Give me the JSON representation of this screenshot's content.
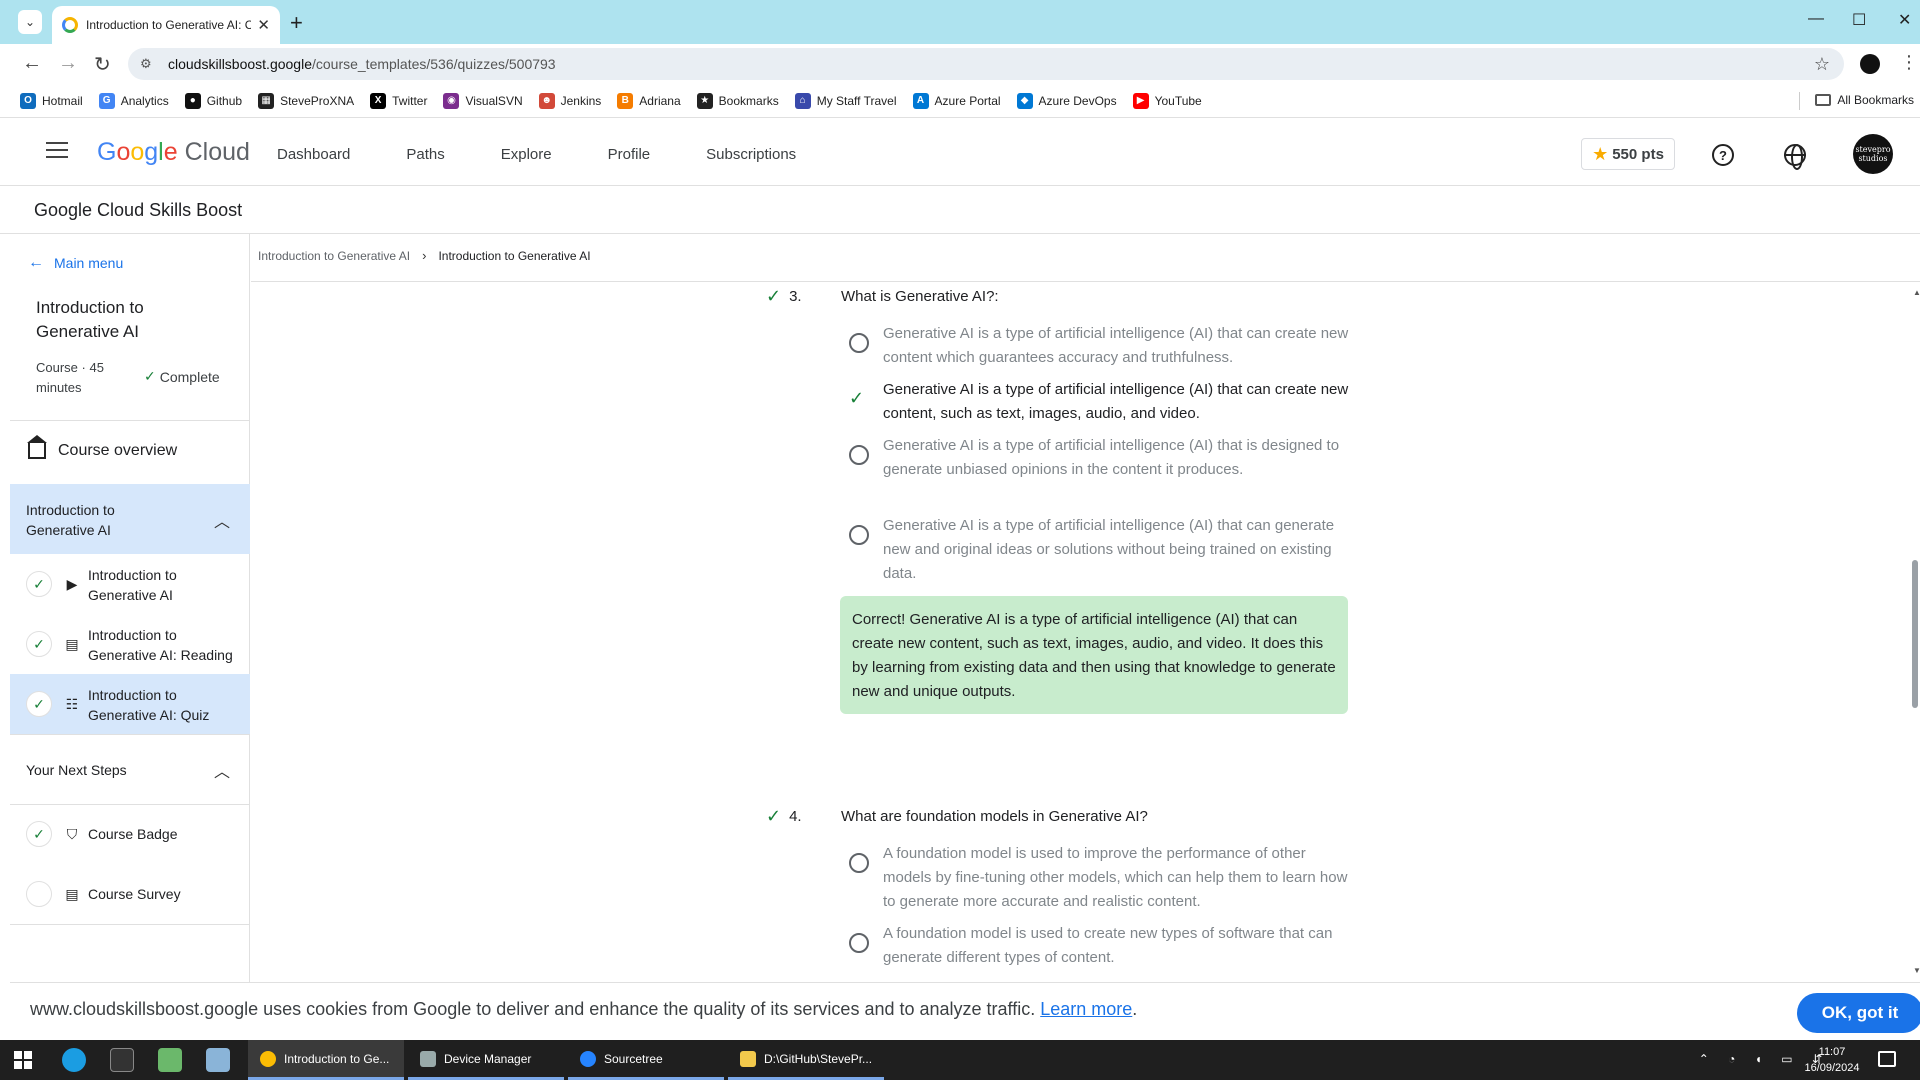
{
  "browser": {
    "tab_title": "Introduction to Generative AI: C",
    "url_host": "cloudskillsboost.google",
    "url_path": "/course_templates/536/quizzes/500793",
    "bookmarks": [
      {
        "label": "Hotmail",
        "color": "#0f6cbd",
        "glyph": "O"
      },
      {
        "label": "Analytics",
        "color": "#4285f4",
        "glyph": "G"
      },
      {
        "label": "Github",
        "color": "#111111",
        "glyph": "●"
      },
      {
        "label": "SteveProXNA",
        "color": "#222222",
        "glyph": "▦"
      },
      {
        "label": "Twitter",
        "color": "#000000",
        "glyph": "X"
      },
      {
        "label": "VisualSVN",
        "color": "#7b2d8e",
        "glyph": "◉"
      },
      {
        "label": "Jenkins",
        "color": "#d24939",
        "glyph": "☻"
      },
      {
        "label": "Adriana",
        "color": "#f57c00",
        "glyph": "B"
      },
      {
        "label": "Bookmarks",
        "color": "#222222",
        "glyph": "★"
      },
      {
        "label": "My Staff Travel",
        "color": "#3949ab",
        "glyph": "⌂"
      },
      {
        "label": "Azure Portal",
        "color": "#0078d4",
        "glyph": "A"
      },
      {
        "label": "Azure DevOps",
        "color": "#0078d4",
        "glyph": "◆"
      },
      {
        "label": "YouTube",
        "color": "#ff0000",
        "glyph": "▶"
      }
    ],
    "all_bookmarks": "All Bookmarks"
  },
  "header": {
    "logo_google": [
      "G",
      "o",
      "o",
      "g",
      "l",
      "e"
    ],
    "logo_cloud": "Cloud",
    "nav": [
      "Dashboard",
      "Paths",
      "Explore",
      "Profile",
      "Subscriptions"
    ],
    "points": "550 pts",
    "help_glyph": "?",
    "avatar_text": "stevepro studios"
  },
  "skills_title": "Google Cloud Skills Boost",
  "sidebar": {
    "main_menu": "Main menu",
    "course_title": "Introduction to Generative AI",
    "course_meta": "Course · 45 minutes",
    "course_status": "Complete",
    "overview": "Course overview",
    "section1": "Introduction to Generative AI",
    "items": [
      {
        "label": "Introduction to Generative AI",
        "icon": "play-circle-icon",
        "glyph": "▶",
        "done": true
      },
      {
        "label": "Introduction to Generative AI: Reading",
        "icon": "document-icon",
        "glyph": "▤",
        "done": true
      },
      {
        "label": "Introduction to Generative AI: Quiz",
        "icon": "quiz-icon",
        "glyph": "☷",
        "done": true
      }
    ],
    "section2": "Your Next Steps",
    "next_steps": [
      {
        "label": "Course Badge",
        "icon": "badge-shield-icon",
        "glyph": "⛉",
        "done": true
      },
      {
        "label": "Course Survey",
        "icon": "document-icon",
        "glyph": "▤",
        "done": false
      }
    ]
  },
  "breadcrumb": {
    "parent": "Introduction to Generative AI",
    "current": "Introduction to Generative AI"
  },
  "quiz": {
    "q3": {
      "number": "3.",
      "text": "What is Generative AI?:",
      "options": [
        "Generative AI is a type of artificial intelligence (AI) that can create new content which guarantees accuracy and truthfulness.",
        "Generative AI is a type of artificial intelligence (AI) that can create new content, such as text, images, audio, and video.",
        "Generative AI is a type of artificial intelligence (AI) that is designed to generate unbiased opinions in the content it produces.",
        "Generative AI is a type of artificial intelligence (AI) that can generate new and original ideas or solutions without being trained on existing data."
      ],
      "feedback": "Correct! Generative AI is a type of artificial intelligence (AI) that can create new content, such as text, images, audio, and video. It does this by learning from existing data and then using that knowledge to generate new and unique outputs."
    },
    "q4": {
      "number": "4.",
      "text": "What are foundation models in Generative AI?",
      "options": [
        "A foundation model is used to improve the performance of other models by fine-tuning other models, which can help them to learn how to generate more accurate and realistic content.",
        "A foundation model is used to create new types of software that can generate different types of content."
      ]
    }
  },
  "cookie": {
    "message": "www.cloudskillsboost.google uses cookies from Google to deliver and enhance the quality of its services and to analyze traffic.",
    "learn_more": "Learn more",
    "period": ".",
    "ok": "OK, got it"
  },
  "taskbar": {
    "apps": [
      "Introduction to Ge...",
      "Device Manager",
      "Sourcetree",
      "D:\\GitHub\\StevePr..."
    ],
    "time": "11:07",
    "date": "16/09/2024"
  },
  "colors": {
    "accent": "#1a73e8",
    "success": "#188038",
    "feedback_bg": "#c8eccd",
    "active_nav": "#d6e7fb"
  }
}
